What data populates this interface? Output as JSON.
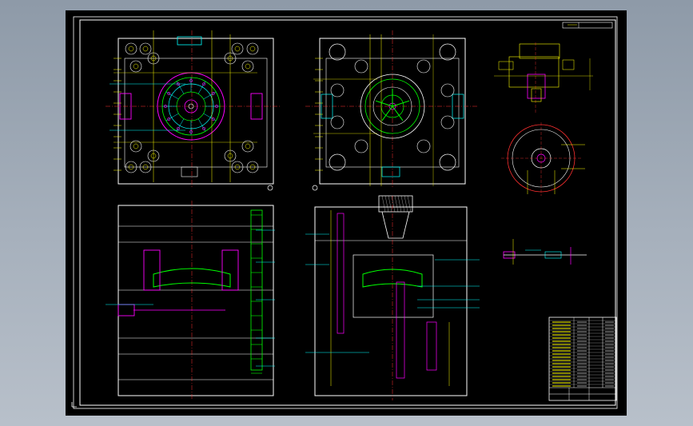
{
  "canvas": {
    "background": "#000000",
    "frame_color": "#ffffff"
  },
  "colors": {
    "outline": "#ffffff",
    "dimension": "#ffff00",
    "leader": "#00ffff",
    "center": "#ff3030",
    "part": "#00ff00",
    "detail": "#ff00ff",
    "hidden": "#ff8080"
  },
  "views": [
    {
      "name": "fixed-half-plan-view"
    },
    {
      "name": "moving-half-plan-view"
    },
    {
      "name": "gate-detail-view"
    },
    {
      "name": "round-part-view"
    },
    {
      "name": "section-a"
    },
    {
      "name": "section-b"
    },
    {
      "name": "small-part-detail"
    }
  ],
  "title_block": {
    "icon": "title-block-table"
  },
  "icons": [
    "crosshair-icon",
    "section-marker-icon",
    "axis-icon"
  ]
}
